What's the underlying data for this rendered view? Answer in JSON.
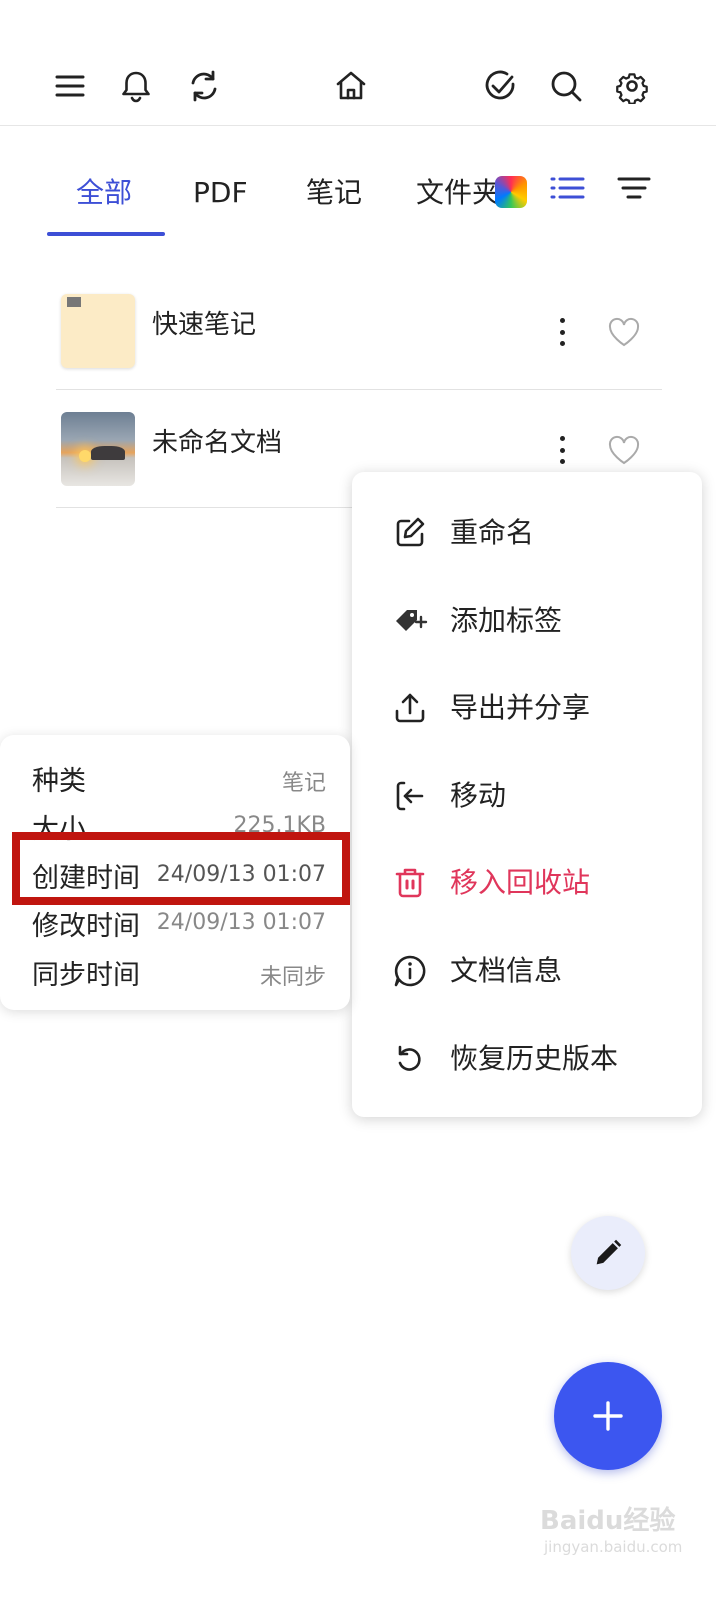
{
  "toolbar": {
    "left_icons": [
      "menu-icon",
      "bell-icon",
      "sync-icon"
    ],
    "center_icon": "home-icon",
    "right_icons": [
      "check-circle-icon",
      "search-icon",
      "gear-icon"
    ]
  },
  "tabs": [
    {
      "label": "全部",
      "active": true
    },
    {
      "label": "PDF",
      "active": false
    },
    {
      "label": "笔记",
      "active": false
    },
    {
      "label": "文件夹",
      "active": false
    }
  ],
  "view_controls": [
    "list-view-icon",
    "sort-filter-icon"
  ],
  "accent_color": "#3d4fd6",
  "files": [
    {
      "name": "快速笔记",
      "thumbnail": "note-thumbnail",
      "favorite": false
    },
    {
      "name": "未命名文档",
      "thumbnail": "photo-thumbnail",
      "favorite": false
    }
  ],
  "context_menu": {
    "items": [
      {
        "label": "重命名",
        "icon": "edit-icon"
      },
      {
        "label": "添加标签",
        "icon": "tag-add-icon"
      },
      {
        "label": "导出并分享",
        "icon": "upload-share-icon"
      },
      {
        "label": "移动",
        "icon": "move-icon"
      },
      {
        "label": "移入回收站",
        "icon": "trash-icon",
        "danger": true,
        "color": "#e0365b"
      },
      {
        "label": "文档信息",
        "icon": "info-icon"
      },
      {
        "label": "恢复历史版本",
        "icon": "history-icon"
      }
    ]
  },
  "doc_info": {
    "rows": [
      {
        "key": "种类",
        "value": "笔记"
      },
      {
        "key": "大小",
        "value": "225.1KB"
      },
      {
        "key": "创建时间",
        "value": "24/09/13 01:07",
        "highlighted": true
      },
      {
        "key": "修改时间",
        "value": "24/09/13 01:07"
      },
      {
        "key": "同步时间",
        "value": "未同步"
      }
    ],
    "highlight_color": "#c0150f"
  },
  "fabs": {
    "edit_icon": "pencil-icon",
    "add_icon": "plus-icon",
    "add_color": "#3c56f0"
  },
  "watermark": {
    "logo": "Baidu经验",
    "site": "jingyan.baidu.com"
  }
}
